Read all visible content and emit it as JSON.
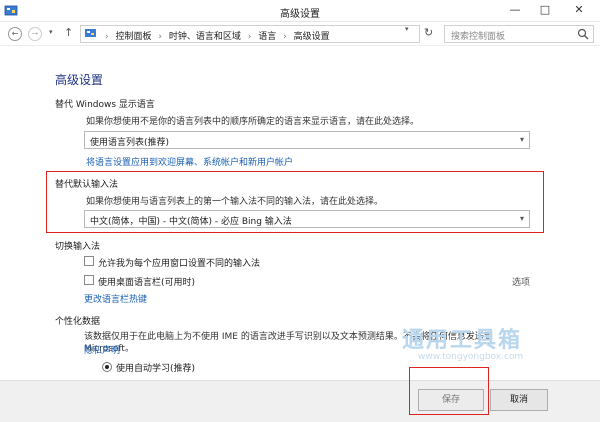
{
  "window": {
    "title": "高级设置",
    "minimize_glyph": "—",
    "maximize_glyph": "□",
    "close_glyph": "✕"
  },
  "nav": {
    "back_glyph": "←",
    "forward_glyph": "→",
    "history_glyph": "▾",
    "up_glyph": "↑",
    "breadcrumbs": [
      "控制面板",
      "时钟、语言和区域",
      "语言",
      "高级设置"
    ],
    "crumb_separator": "›",
    "address_dropdown_glyph": "▾",
    "refresh_glyph": "↻",
    "search_placeholder": "搜索控制面板"
  },
  "page": {
    "heading": "高级设置",
    "display_language": {
      "label": "替代 Windows 显示语言",
      "description": "如果你想使用不是你的语言列表中的顺序所确定的语言来显示语言，请在此处选择。",
      "selected": "使用语言列表(推荐)",
      "link": "将语言设置应用到欢迎屏幕、系统帐户和新用户帐户"
    },
    "default_input": {
      "label": "替代默认输入法",
      "description": "如果你想使用与语言列表上的第一个输入法不同的输入法，请在此处选择。",
      "selected": "中文(简体，中国) - 中文(简体) - 必应 Bing 输入法"
    },
    "switch_input": {
      "label": "切换输入法",
      "checkbox1": "允许我为每个应用窗口设置不同的输入法",
      "checkbox2": "使用桌面语言栏(可用时)",
      "options_link": "选项",
      "hotkey_link": "更改语言栏热键"
    },
    "personalization": {
      "label": "个性化数据",
      "description": "该数据仅用于在此电脑上为不使用 IME 的语言改进手写识别以及文本预测结果。不会将任何信息发送到 Microsoft。",
      "privacy_link": "隐私声明",
      "radio_label": "使用自动学习(推荐)"
    },
    "watermark_text": "通用工具箱",
    "watermark_url": "www.tongyongbox.com"
  },
  "footer": {
    "save": "保存",
    "cancel": "取消"
  },
  "colors": {
    "heading": "#1e3287",
    "link": "#1a5fb4",
    "highlight_border": "#dd2222"
  }
}
